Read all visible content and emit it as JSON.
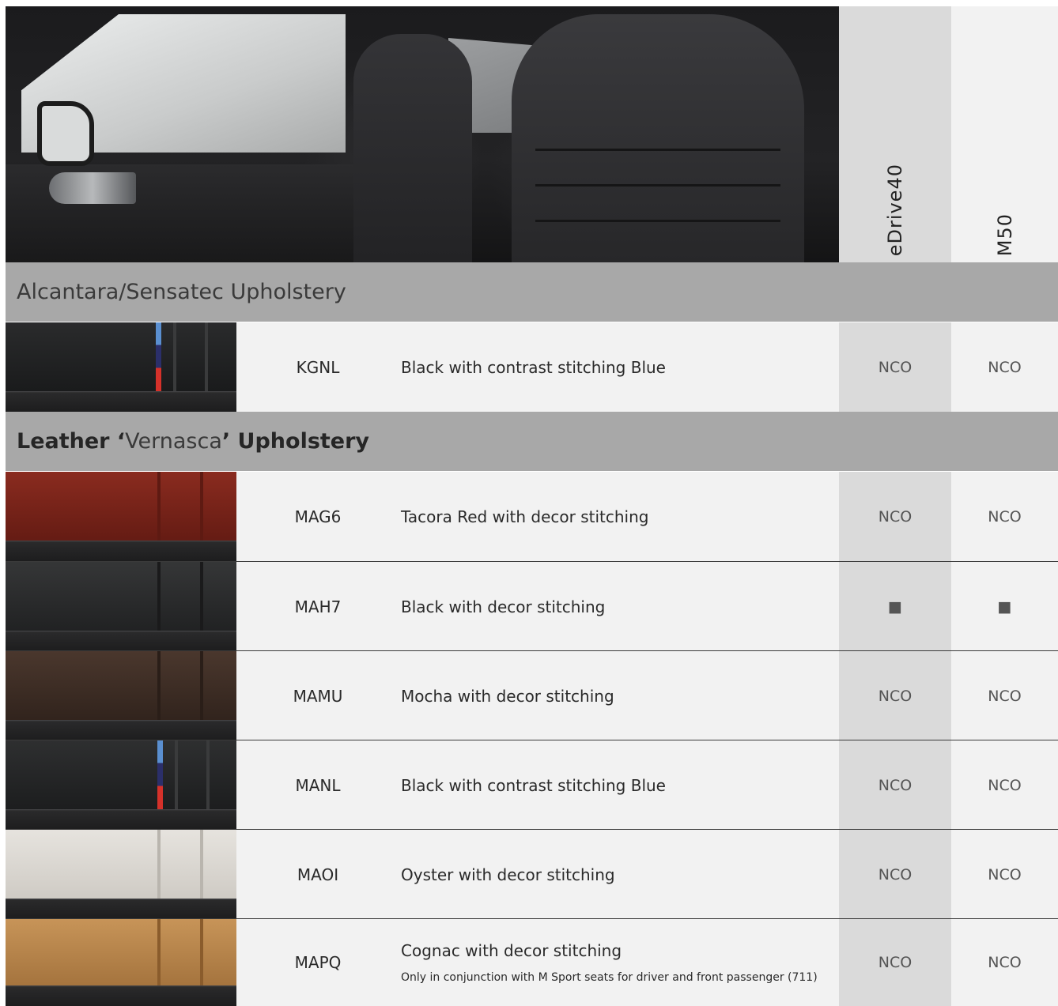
{
  "header": {
    "columns": [
      "eDrive40",
      "M50"
    ]
  },
  "sections": [
    {
      "title": "Alcantara/Sensatec Upholstery",
      "rows": [
        {
          "code": "KGNL",
          "description": "Black with contrast stitching Blue",
          "note": "",
          "edrive40": "NCO",
          "m50": "NCO",
          "swatch_color": "#1e1f20",
          "stripe": "m-colors"
        }
      ]
    },
    {
      "title_parts": [
        "Leather ‘",
        "Vernasca",
        "’ Upholstery"
      ],
      "rows": [
        {
          "code": "MAG6",
          "description": "Tacora Red with decor stitching",
          "note": "",
          "edrive40": "NCO",
          "m50": "NCO",
          "swatch_color": "#7a2419",
          "stripe": ""
        },
        {
          "code": "MAH7",
          "description": "Black with decor stitching",
          "note": "",
          "edrive40": "■",
          "m50": "■",
          "swatch_color": "#2a2b2c",
          "stripe": ""
        },
        {
          "code": "MAMU",
          "description": "Mocha with decor stitching",
          "note": "",
          "edrive40": "NCO",
          "m50": "NCO",
          "swatch_color": "#3f2f27",
          "stripe": ""
        },
        {
          "code": "MANL",
          "description": "Black with contrast stitching Blue",
          "note": "",
          "edrive40": "NCO",
          "m50": "NCO",
          "swatch_color": "#232425",
          "stripe": "m-colors"
        },
        {
          "code": "MAOI",
          "description": "Oyster with decor stitching",
          "note": "",
          "edrive40": "NCO",
          "m50": "NCO",
          "swatch_color": "#d9d5cf",
          "stripe": ""
        },
        {
          "code": "MAPQ",
          "description": "Cognac with decor stitching",
          "note": "Only in conjunction with M Sport seats for driver and front passenger (711)",
          "edrive40": "NCO",
          "m50": "NCO",
          "swatch_color": "#b98249",
          "stripe": ""
        }
      ]
    }
  ]
}
